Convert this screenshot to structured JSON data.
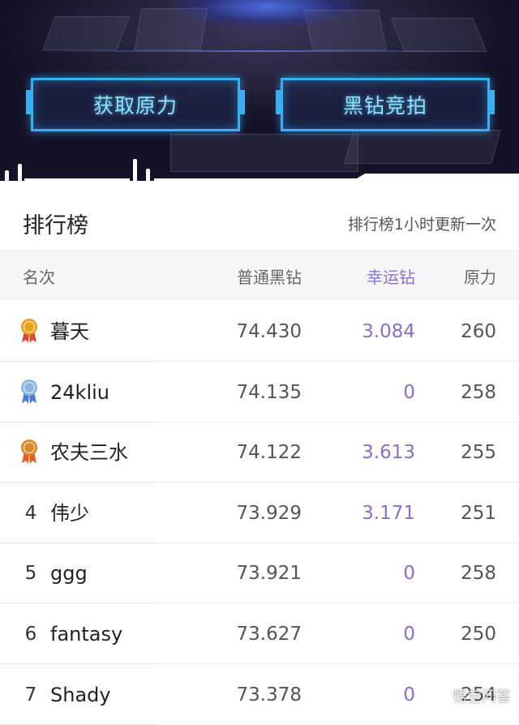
{
  "hero": {
    "buttons": [
      {
        "label": "获取原力"
      },
      {
        "label": "黑钻竞拍"
      }
    ]
  },
  "leaderboard": {
    "title": "排行榜",
    "update_note": "排行榜1小时更新一次",
    "columns": {
      "rank": "名次",
      "normal_diamond": "普通黑钻",
      "lucky_diamond": "幸运钻",
      "force": "原力"
    },
    "rows": [
      {
        "rank": "",
        "medal": "gold-medal-icon",
        "name": "暮天",
        "normal": "74.430",
        "lucky": "3.084",
        "force": "260"
      },
      {
        "rank": "",
        "medal": "silver-medal-icon",
        "name": "24kliu",
        "normal": "74.135",
        "lucky": "0",
        "force": "258"
      },
      {
        "rank": "",
        "medal": "bronze-medal-icon",
        "name": "农夫三水",
        "normal": "74.122",
        "lucky": "3.613",
        "force": "255"
      },
      {
        "rank": "4",
        "medal": "",
        "name": "伟少",
        "normal": "73.929",
        "lucky": "3.171",
        "force": "251"
      },
      {
        "rank": "5",
        "medal": "",
        "name": "ggg",
        "normal": "73.921",
        "lucky": "0",
        "force": "258"
      },
      {
        "rank": "6",
        "medal": "",
        "name": "fantasy",
        "normal": "73.627",
        "lucky": "0",
        "force": "250"
      },
      {
        "rank": "7",
        "medal": "",
        "name": "Shady",
        "normal": "73.378",
        "lucky": "0",
        "force": "254"
      }
    ]
  },
  "watermark": {
    "text": "悟空问答"
  },
  "colors": {
    "accent_lucky": "#8a6fc8",
    "hero_button_border": "#3ab0f0",
    "gold": "#e8a21e",
    "silver": "#8fb4e0",
    "bronze": "#d9892a"
  }
}
